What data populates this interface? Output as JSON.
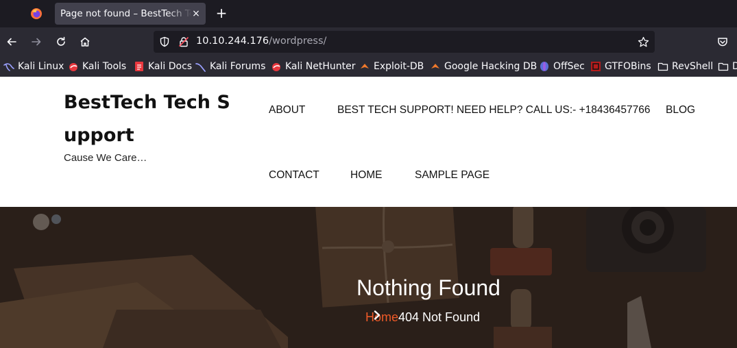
{
  "browser": {
    "tab_title": "Page not found – BestTech Tech Support",
    "tab_close": "×",
    "new_tab": "+",
    "url_host": "10.10.244.176",
    "url_path": "/wordpress/"
  },
  "bookmarks": [
    {
      "label": "Kali Linux",
      "icon": "kali-dragon-icon"
    },
    {
      "label": "Kali Tools",
      "icon": "kali-tools-icon"
    },
    {
      "label": "Kali Docs",
      "icon": "kali-docs-icon"
    },
    {
      "label": "Kali Forums",
      "icon": "kali-forums-icon"
    },
    {
      "label": "Kali NetHunter",
      "icon": "kali-nethunter-icon"
    },
    {
      "label": "Exploit-DB",
      "icon": "exploit-db-icon"
    },
    {
      "label": "Google Hacking DB",
      "icon": "ghdb-icon"
    },
    {
      "label": "OffSec",
      "icon": "offsec-icon"
    },
    {
      "label": "GTFOBins",
      "icon": "gtfobins-icon"
    },
    {
      "label": "RevShell",
      "icon": "folder-icon"
    },
    {
      "label": "D",
      "icon": "folder-icon"
    }
  ],
  "site": {
    "title": "BestTech Tech Support",
    "tagline": "Cause We Care…",
    "menu": [
      "ABOUT",
      "BEST TECH SUPPORT! NEED HELP? CALL US:- +18436457766",
      "BLOG",
      "CONTACT",
      "HOME",
      "SAMPLE PAGE"
    ]
  },
  "hero": {
    "title": "Nothing Found",
    "breadcrumb_home": "Home",
    "breadcrumb_current": "404 Not Found"
  },
  "colors": {
    "accent": "#f05a28",
    "chrome_dark": "#1c1b22",
    "chrome": "#2b2a33"
  }
}
